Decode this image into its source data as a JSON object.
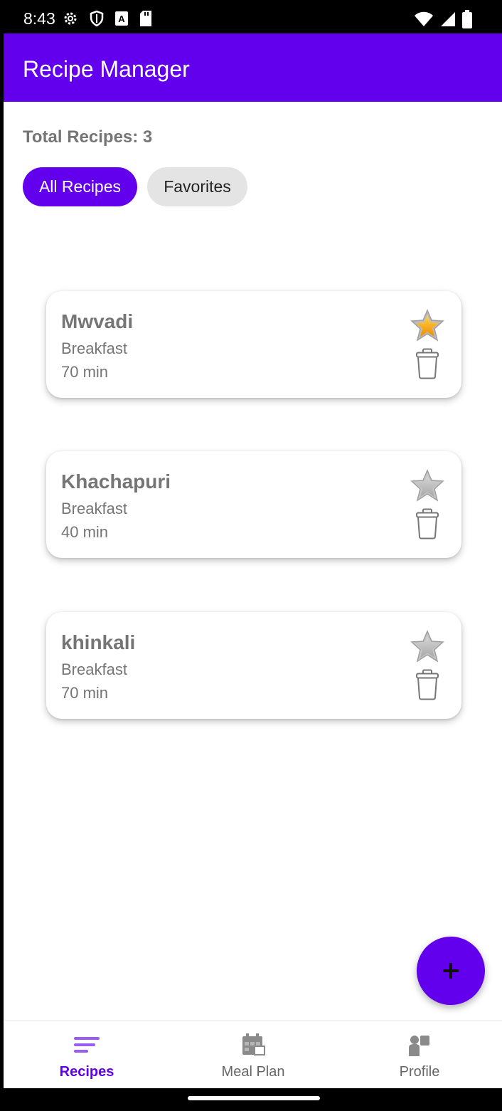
{
  "status_bar": {
    "time": "8:43",
    "left_icons": [
      "settings-icon",
      "shield-icon",
      "text-a-icon",
      "sd-card-icon"
    ],
    "right_icons": [
      "wifi-icon",
      "signal-icon",
      "battery-icon"
    ]
  },
  "app_bar": {
    "title": "Recipe Manager"
  },
  "summary": {
    "total_label": "Total Recipes: 3"
  },
  "filters": {
    "all_label": "All Recipes",
    "favorites_label": "Favorites",
    "selected": "All Recipes"
  },
  "recipes": [
    {
      "name": "Mwvadi",
      "category": "Breakfast",
      "time": "70 min",
      "favorite": true
    },
    {
      "name": "Khachapuri",
      "category": "Breakfast",
      "time": "40 min",
      "favorite": false
    },
    {
      "name": "khinkali",
      "category": "Breakfast",
      "time": "70 min",
      "favorite": false
    }
  ],
  "fab": {
    "icon": "plus-icon"
  },
  "bottom_nav": {
    "items": [
      {
        "label": "Recipes",
        "icon": "recipes-icon",
        "active": true
      },
      {
        "label": "Meal Plan",
        "icon": "calendar-icon",
        "active": false
      },
      {
        "label": "Profile",
        "icon": "profile-icon",
        "active": false
      }
    ]
  },
  "colors": {
    "primary": "#6200ee",
    "chip_inactive": "#e4e4e4",
    "text_secondary": "#757575",
    "star_active": "#f5a623",
    "star_inactive": "#bdbdbd"
  }
}
